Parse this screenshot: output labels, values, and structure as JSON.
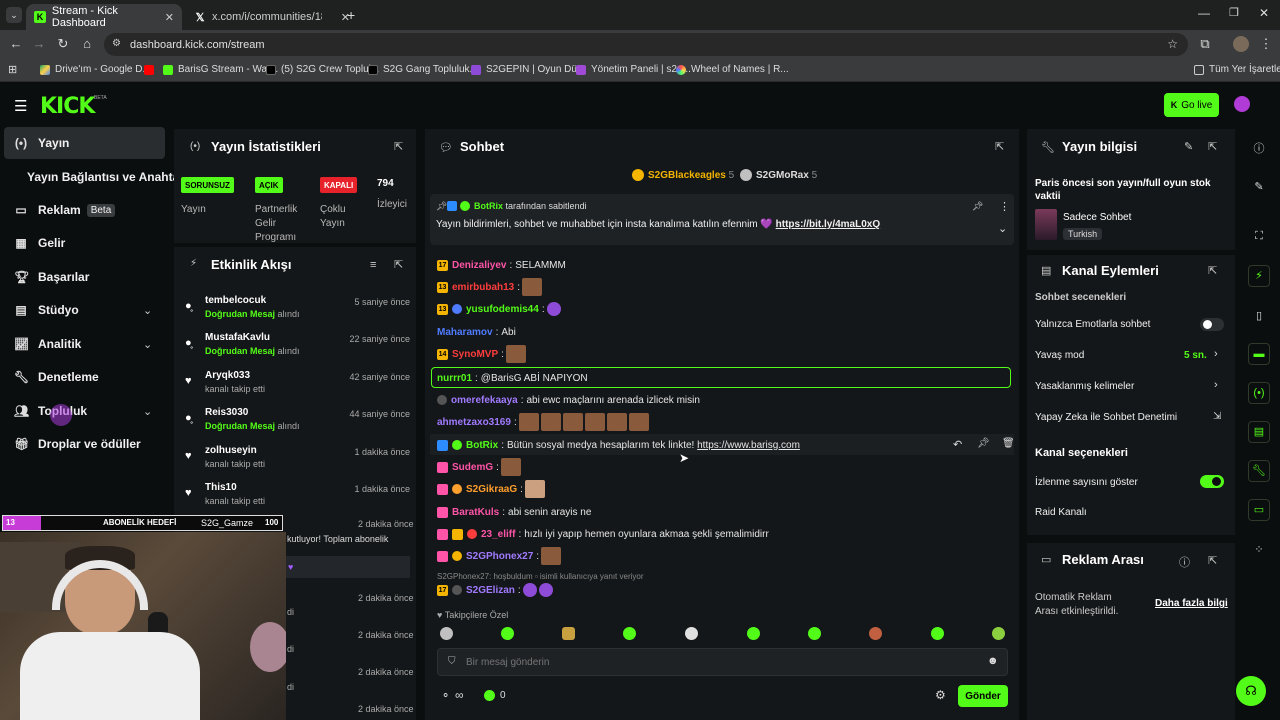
{
  "browser": {
    "tabs": [
      {
        "title": "Stream - Kick Dashboard",
        "active": true
      },
      {
        "title": "x.com/i/communities/1835319",
        "active": false
      }
    ],
    "url": "dashboard.kick.com/stream",
    "bookmarks": [
      "Drive'ım - Google D...",
      "BarisG Stream - Wat...",
      "(5) S2G Crew Toplul...",
      "S2G Gang Topluluk...",
      "S2GEPIN | Oyun Dü...",
      "Yönetim Paneli | s2g...",
      "Wheel of Names | R...",
      "Tüm Yer İşaretleri"
    ]
  },
  "header": {
    "logo": "KICK",
    "logo_sup": "BETA",
    "go_live": "Go live"
  },
  "sidebar": {
    "items": [
      {
        "label": "Yayın",
        "icon": "broadcast-icon"
      },
      {
        "label": "Yayın Bağlantısı ve Anahtarı",
        "icon": ""
      },
      {
        "label": "Reklam",
        "icon": "ad-icon",
        "badge": "Beta"
      },
      {
        "label": "Gelir",
        "icon": "revenue-icon"
      },
      {
        "label": "Başarılar",
        "icon": "trophy-icon"
      },
      {
        "label": "Stüdyo",
        "icon": "studio-icon"
      },
      {
        "label": "Analitik",
        "icon": "chart-icon"
      },
      {
        "label": "Denetleme",
        "icon": "wrench-icon"
      },
      {
        "label": "Topluluk",
        "icon": "community-icon"
      },
      {
        "label": "Droplar ve ödüller",
        "icon": "gift-icon"
      }
    ]
  },
  "stats": {
    "title": "Yayın İstatistikleri",
    "items": [
      {
        "badge": "SORUNSUZ",
        "label": "Yayın"
      },
      {
        "badge": "AÇIK",
        "label": "Partnerlik Gelir Programı"
      },
      {
        "badge": "KAPALI",
        "label": "Çoklu Yayın"
      },
      {
        "badge": "794",
        "label": "İzleyici"
      }
    ]
  },
  "activity": {
    "title": "Etkinlik Akışı",
    "events": [
      {
        "name": "tembelcocuk",
        "type_strong": "Doğrudan Mesaj",
        "type": "alındı",
        "time": "5 saniye önce",
        "icon": "message-icon"
      },
      {
        "name": "MustafaKavlu",
        "type_strong": "Doğrudan Mesaj",
        "type": "alındı",
        "time": "22 saniye önce",
        "icon": "message-icon"
      },
      {
        "name": "Aryqk033",
        "type_strong": "",
        "type": "kanalı takip etti",
        "time": "42 saniye önce",
        "icon": "heart-icon"
      },
      {
        "name": "Reis3030",
        "type_strong": "Doğrudan Mesaj",
        "type": "alındı",
        "time": "44 saniye önce",
        "icon": "message-icon"
      },
      {
        "name": "zolhuseyin",
        "type_strong": "",
        "type": "kanalı takip etti",
        "time": "1 dakika önce",
        "icon": "heart-icon"
      },
      {
        "name": "This10",
        "type_strong": "",
        "type": "kanalı takip etti",
        "time": "1 dakika önce",
        "icon": "heart-icon"
      }
    ],
    "partial_times": [
      "2 dakika önce",
      "2 dakika önce",
      "2 dakika önce",
      "2 dakika önce",
      "2 dakika önce"
    ],
    "partial_text": "kutluyor! Toplam abonelik",
    "partial_suffix": [
      "di",
      "di",
      "di",
      "di"
    ]
  },
  "overlay": {
    "sub_count": "13",
    "sub_goal_label": "ABONELİK HEDEFİ",
    "sub_name": "S2G_Gamze",
    "sub_goal": "100"
  },
  "chat": {
    "title": "Sohbet",
    "top_supporters": [
      {
        "name": "S2GBlackeagles",
        "count": "5"
      },
      {
        "name": "S2GMoRax",
        "count": "5"
      }
    ],
    "pinned": {
      "by": "BotRix",
      "by_suffix": "tarafından sabitlendi",
      "text": "Yayın bildirimleri, sohbet ve muhabbet için insta kanalıma katılın efennim 💜",
      "link": "https://bit.ly/4maL0xQ"
    },
    "messages": [
      {
        "badge": "17",
        "user": "Denizaliyev",
        "color": "#ff54a8",
        "text": "SELAMMM"
      },
      {
        "badge": "13",
        "user": "emirbubah13",
        "color": "#ff3d3d",
        "text": ""
      },
      {
        "badge": "13",
        "user": "yusufodemis44",
        "color": "#53fc18",
        "text": ""
      },
      {
        "badge": "",
        "user": "Maharamov",
        "color": "#4f7bff",
        "text": "Abi"
      },
      {
        "badge": "14",
        "user": "SynoMVP",
        "color": "#ff3d3d",
        "text": ""
      },
      {
        "badge": "",
        "user": "nurrr01",
        "color": "#53fc18",
        "text": "@BarisG ABİ NAPIYON"
      },
      {
        "badge": "",
        "user": "omerefekaaya",
        "color": "#a07aff",
        "text": "abi ewc maçlarını arenada izlicek misin"
      },
      {
        "badge": "",
        "user": "ahmetzaxo3169",
        "color": "#a07aff",
        "text": ""
      },
      {
        "badge": "",
        "user": "BotRix",
        "color": "#53fc18",
        "text": "Bütün sosyal medya hesaplarım tek linkte!",
        "link": "https://www.barisg.com"
      },
      {
        "badge": "",
        "user": "SudemG",
        "color": "#ff54a8",
        "text": ""
      },
      {
        "badge": "",
        "user": "S2GikraaG",
        "color": "#ff9f2d",
        "text": ""
      },
      {
        "badge": "",
        "user": "BaratKuls",
        "color": "#ff54a8",
        "text": "abi senin arayis ne"
      },
      {
        "badge": "",
        "user": "23_eliff",
        "color": "#ff54a8",
        "text": "hızlı iyi yapıp hemen oyunlara akmaa şekli şemalimidirr"
      },
      {
        "badge": "",
        "user": "S2GPhonex27",
        "color": "#a07aff",
        "text": ""
      },
      {
        "badge": "17",
        "user": "S2GElizan",
        "color": "#a07aff",
        "text": ""
      }
    ],
    "reply_hint": "S2GPhonex27: hoşbuldum",
    "reply_hint_suffix": "isimli kullanıcıya yanıt veriyor",
    "followers_only": "Takipçilere Özel",
    "input_placeholder": "Bir mesaj gönderin",
    "infinity": "∞",
    "points": "0",
    "send": "Gönder"
  },
  "stream_info": {
    "title": "Yayın bilgisi",
    "stream_title": "Paris öncesi son yayın/full oyun stok vaktii",
    "category": "Sadece Sohbet",
    "language": "Turkish"
  },
  "channel_actions": {
    "title": "Kanal Eylemleri",
    "chat_options_title": "Sohbet seçenekleri",
    "emote_only": "Yalnızca Emotlarla sohbet",
    "slow_mode": "Yavaş mod",
    "slow_mode_value": "5 sn.",
    "banned_words": "Yasaklanmış kelimeler",
    "ai_moderation": "Yapay Zeka ile Sohbet Denetimi",
    "channel_options_title": "Kanal seçenekleri",
    "show_viewers": "İzlenme sayısını göster",
    "raid": "Raid Kanalı"
  },
  "ad_break": {
    "title": "Reklam Arası",
    "text": "Otomatik Reklam Arası etkinleştirildi.",
    "link": "Daha fazla bilgi"
  },
  "colors": {
    "accent": "#53fc18",
    "panel": "#141719",
    "bg": "#0b0e0f"
  }
}
